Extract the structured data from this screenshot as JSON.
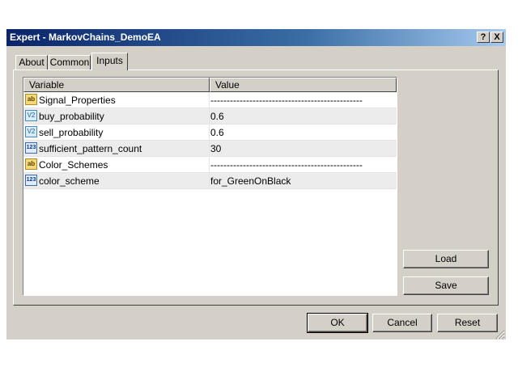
{
  "window": {
    "title": "Expert - MarkovChains_DemoEA",
    "help_label": "?",
    "close_label": "X"
  },
  "tabs": [
    {
      "label": "About"
    },
    {
      "label": "Common"
    },
    {
      "label": "Inputs"
    }
  ],
  "table": {
    "columns": [
      "Variable",
      "Value"
    ],
    "rows": [
      {
        "icon": "ab",
        "icon_name": "string-type-icon",
        "variable": "Signal_Properties",
        "value": "-----------------------------------------------"
      },
      {
        "icon": "V2",
        "icon_name": "double-type-icon",
        "variable": "buy_probability",
        "value": "0.6"
      },
      {
        "icon": "V2",
        "icon_name": "double-type-icon",
        "variable": "sell_probability",
        "value": "0.6"
      },
      {
        "icon": "123",
        "icon_name": "integer-type-icon",
        "variable": "sufficient_pattern_count",
        "value": "30"
      },
      {
        "icon": "ab",
        "icon_name": "string-type-icon",
        "variable": "Color_Schemes",
        "value": "-----------------------------------------------"
      },
      {
        "icon": "123",
        "icon_name": "integer-type-icon",
        "variable": "color_scheme",
        "value": "for_GreenOnBlack"
      }
    ]
  },
  "side_buttons": {
    "load": "Load",
    "save": "Save"
  },
  "footer_buttons": {
    "ok": "OK",
    "cancel": "Cancel",
    "reset": "Reset"
  }
}
